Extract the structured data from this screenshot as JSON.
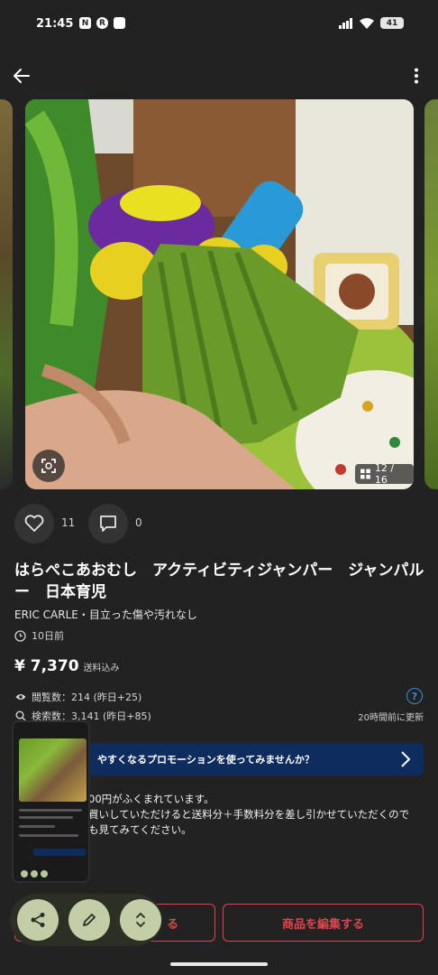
{
  "status_bar": {
    "time": "21:45",
    "left_icon_labels": [
      "N",
      "R"
    ],
    "battery": "41"
  },
  "carousel": {
    "counter": "12 / 16"
  },
  "actions": {
    "like_count": "11",
    "comment_count": "0"
  },
  "item": {
    "title": "はらぺこあおむし　アクティビティジャンパー　ジャンパルー　日本育児",
    "subtitle": "ERIC CARLE・目立った傷や汚れなし",
    "listed_ago": "10日前",
    "price": "¥ 7,370",
    "shipping_note": "送料込み",
    "views": "閲覧数：214 (昨日+25)",
    "searches": "検索数：3,141 (昨日+85)",
    "updated": "20時間前に更新"
  },
  "promo": {
    "banner_text": "やすくなるプロモーションを使ってみませんか？",
    "info_lines": [
      "00円がふくまれています。",
      "買いしていただけると送料分＋手数料分を差し引かせていただくので",
      "も見てみてください。"
    ]
  },
  "buttons": {
    "promote_label": "る",
    "edit_label": "商品を編集する"
  },
  "colors": {
    "background": "#222222",
    "accent_red": "#e0444e",
    "promo_blue": "#0e2c5e",
    "help_blue": "#3b8bd6",
    "fab_green": "#c3cda8"
  },
  "icons": [
    "back-arrow-icon",
    "more-vertical-icon",
    "scan-icon",
    "gallery-grid-icon",
    "heart-icon",
    "comment-icon",
    "clock-icon",
    "eye-icon",
    "search-icon",
    "help-icon",
    "chevron-right-icon",
    "share-icon",
    "pencil-icon",
    "expand-icon"
  ]
}
